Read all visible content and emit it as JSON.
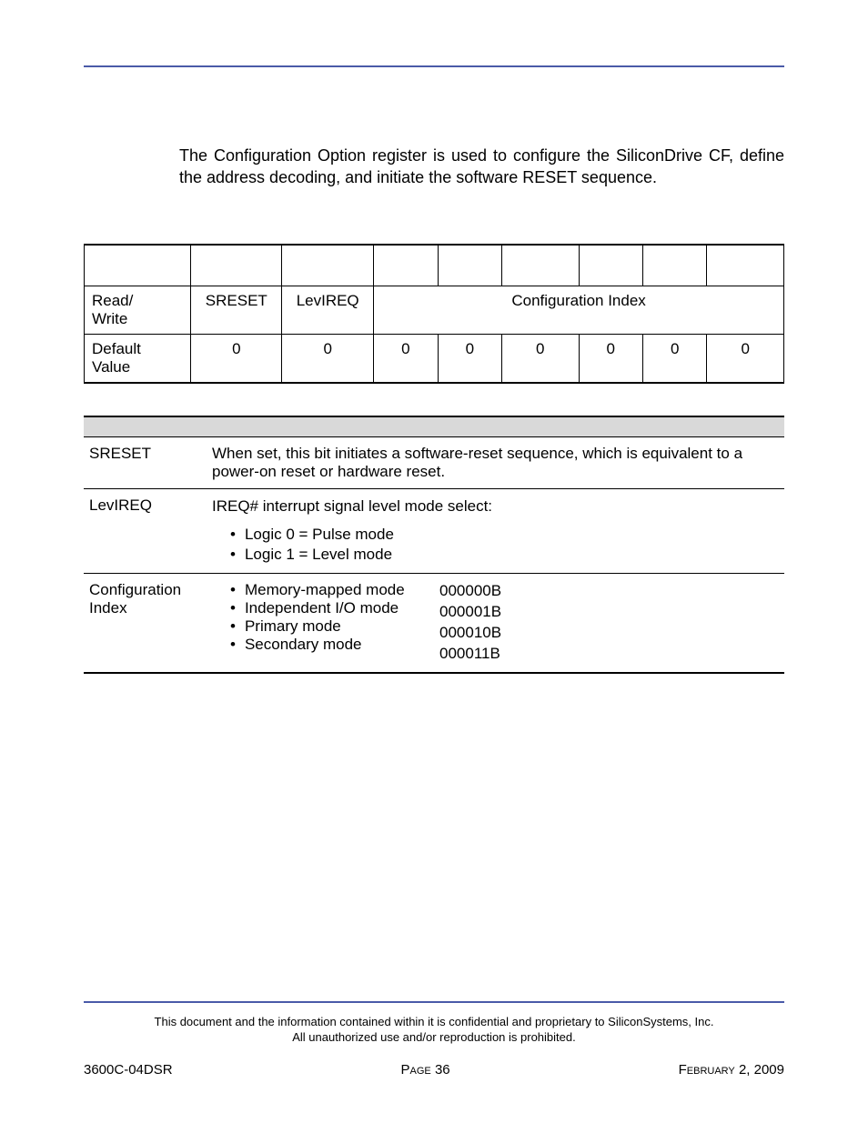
{
  "intro": "The Configuration Option register is used to configure the SiliconDrive CF, define the address decoding, and initiate the software RESET sequence.",
  "table1": {
    "row_rw_label": "Read/\nWrite",
    "row_rw": {
      "b7": "SRESET",
      "b6": "LevIREQ",
      "span": "Configuration Index"
    },
    "row_default_label": "Default\nValue",
    "defaults": [
      "0",
      "0",
      "0",
      "0",
      "0",
      "0",
      "0",
      "0"
    ]
  },
  "table2": {
    "rows": [
      {
        "name": "SRESET",
        "desc": "When set, this bit initiates a software-reset sequence, which is equivalent to a power-on reset or hardware reset."
      },
      {
        "name": "LevIREQ",
        "main": "IREQ# interrupt signal level mode select:",
        "bullets": [
          "Logic 0 = Pulse mode",
          "Logic 1 = Level mode"
        ]
      },
      {
        "name": "Configuration Index",
        "modes": [
          {
            "label": "Memory-mapped mode",
            "code": "000000B"
          },
          {
            "label": "Independent I/O mode",
            "code": "000001B"
          },
          {
            "label": "Primary mode",
            "code": "000010B"
          },
          {
            "label": "Secondary mode",
            "code": "000011B"
          }
        ]
      }
    ]
  },
  "footer": {
    "disclaimer1": "This document and the information contained within it is confidential and proprietary to SiliconSystems, Inc.",
    "disclaimer2": "All unauthorized use and/or reproduction is prohibited.",
    "doc_id": "3600C-04DSR",
    "page_prefix": "Page",
    "page_num": "36",
    "date_prefix": "February",
    "date_rest": "2, 2009"
  }
}
